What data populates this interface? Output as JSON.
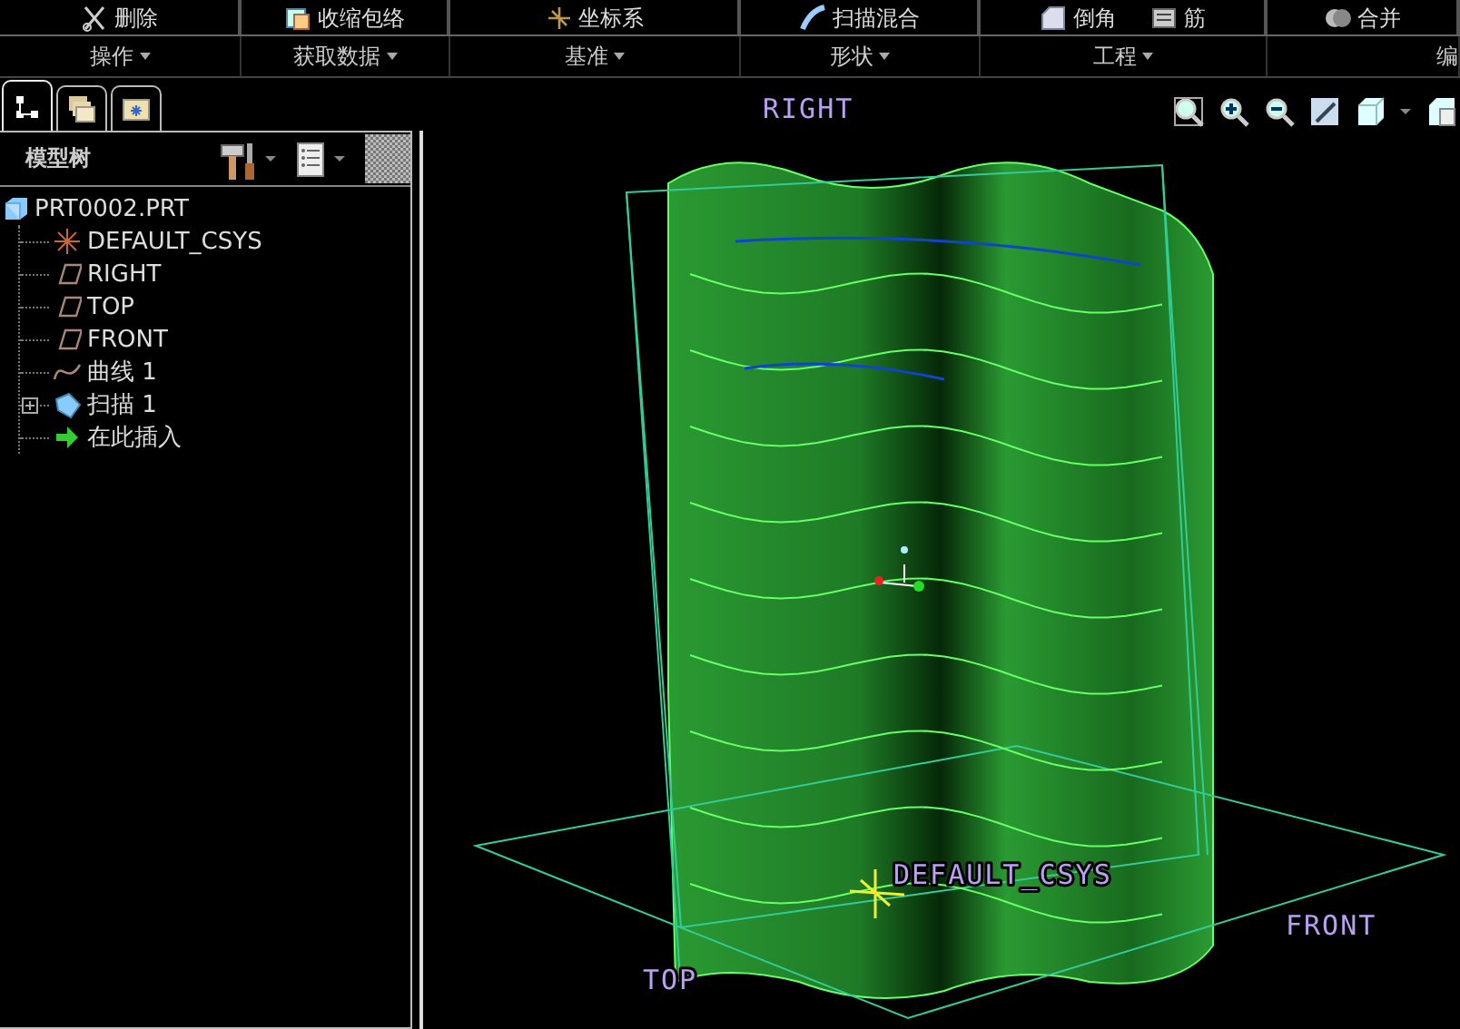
{
  "ribbon": {
    "buttons": [
      {
        "label": "删除",
        "kind": "scissors"
      },
      {
        "label": "收缩包络",
        "kind": "wrap"
      },
      {
        "label": "坐标系",
        "kind": "csys"
      },
      {
        "label": "扫描混合",
        "kind": "sweep"
      },
      {
        "label": "倒角",
        "kind": "chamfer"
      },
      {
        "label": "筋",
        "kind": "rib"
      },
      {
        "label": "合并",
        "kind": "merge"
      }
    ],
    "groups": [
      {
        "label": "操作"
      },
      {
        "label": "获取数据"
      },
      {
        "label": "基准"
      },
      {
        "label": "形状"
      },
      {
        "label": "工程"
      },
      {
        "label": "编"
      }
    ]
  },
  "model_tree": {
    "tabs": [
      {
        "kind": "tree",
        "selected": true
      },
      {
        "kind": "layers",
        "selected": false
      },
      {
        "kind": "folder",
        "selected": false
      }
    ],
    "title": "模型树",
    "root": {
      "label": "PRT0002.PRT",
      "children": [
        {
          "label": "DEFAULT_CSYS",
          "kind": "csys"
        },
        {
          "label": "RIGHT",
          "kind": "plane"
        },
        {
          "label": "TOP",
          "kind": "plane"
        },
        {
          "label": "FRONT",
          "kind": "plane"
        },
        {
          "label": "曲线 1",
          "kind": "curve"
        },
        {
          "label": "扫描 1",
          "kind": "sweep",
          "expanded": false
        },
        {
          "label": "在此插入",
          "kind": "insert"
        }
      ]
    }
  },
  "viewport": {
    "datum_labels": [
      {
        "label": "RIGHT"
      },
      {
        "label": "DEFAULT_CSYS"
      },
      {
        "label": "FRONT"
      },
      {
        "label": "TOP"
      }
    ]
  }
}
